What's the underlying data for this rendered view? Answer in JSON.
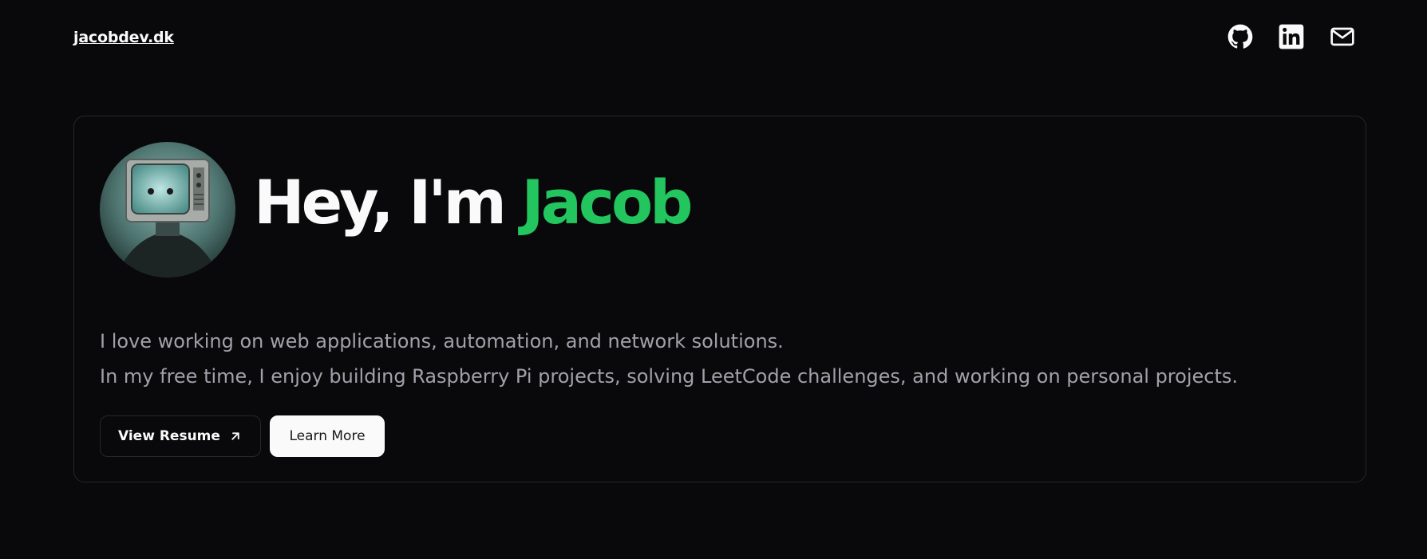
{
  "header": {
    "site_link": "jacobdev.dk",
    "socials": [
      {
        "icon": "github-icon"
      },
      {
        "icon": "linkedin-icon"
      },
      {
        "icon": "mail-icon"
      }
    ]
  },
  "hero": {
    "avatar_icon": "avatar-image",
    "headline_prefix": "Hey, I'm ",
    "headline_name": "Jacob",
    "intro_lines": [
      "I love working on web applications, automation, and network solutions.",
      "In my free time, I enjoy building Raspberry Pi projects, solving LeetCode challenges, and working on personal projects."
    ],
    "buttons": {
      "resume_label": "View Resume",
      "learn_more_label": "Learn More"
    }
  },
  "colors": {
    "background": "#09090b",
    "accent": "#22c55e",
    "muted_text": "#a1a1aa",
    "border": "#27272a"
  }
}
